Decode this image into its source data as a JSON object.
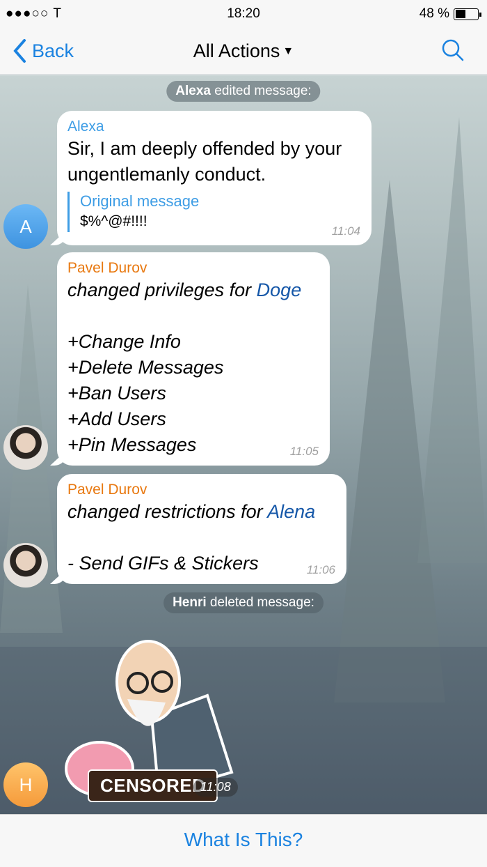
{
  "status_bar": {
    "signal": "●●●○○ T",
    "time": "18:20",
    "battery": "48 %",
    "battery_level": 0.48
  },
  "nav": {
    "back_label": "Back",
    "title": "All Actions",
    "title_icon": "triangle-down-icon",
    "search_icon": "search-icon"
  },
  "colors": {
    "accent": "#1a82e0",
    "alexa": "#3e9de5",
    "pavel": "#e8780f",
    "link": "#1557a8"
  },
  "messages": [
    {
      "type": "service",
      "actor": "Alexa",
      "text": "edited message:"
    },
    {
      "type": "bubble",
      "sender": "Alexa",
      "text_lines": [
        "Sir, I am deeply offended by your",
        "ungentlemanly conduct."
      ],
      "quote_title": "Original message",
      "quote_text": "$%^@#!!!!",
      "time": "11:04",
      "avatar": "A"
    },
    {
      "type": "bubble",
      "sender": "Pavel Durov",
      "action": "changed privileges for ",
      "target": "Doge",
      "lines": [
        "+Change Info",
        "+Delete Messages",
        "+Ban Users",
        "+Add Users",
        "+Pin Messages"
      ],
      "time": "11:05"
    },
    {
      "type": "bubble",
      "sender": "Pavel Durov",
      "action": "changed restrictions for ",
      "target": "Alena",
      "lines": [
        "- Send GIFs & Stickers"
      ],
      "time": "11:06"
    },
    {
      "type": "service",
      "actor": "Henri",
      "text": "deleted message:"
    },
    {
      "type": "sticker",
      "sticker_text": "CENSORED",
      "time": "11:08",
      "avatar": "H"
    }
  ],
  "bottom": {
    "label": "What Is This?"
  }
}
